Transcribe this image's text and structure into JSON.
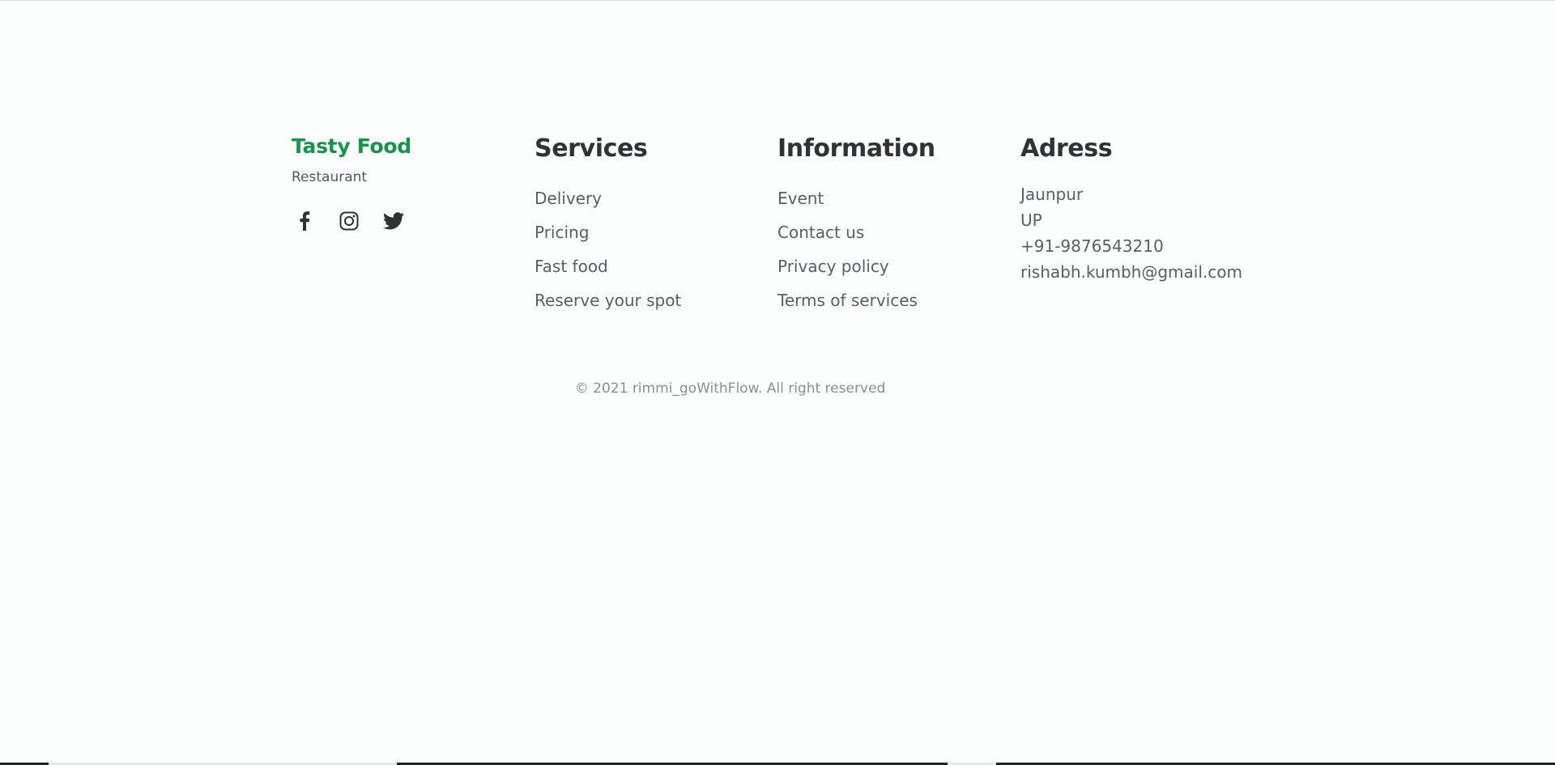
{
  "brand": {
    "name": "Tasty Food",
    "subtitle": "Restaurant",
    "accent_color": "#139647"
  },
  "socials": [
    {
      "icon": "facebook-icon"
    },
    {
      "icon": "instagram-icon"
    },
    {
      "icon": "twitter-icon"
    }
  ],
  "services": {
    "heading": "Services",
    "items": [
      "Delivery",
      "Pricing",
      "Fast food",
      "Reserve your spot"
    ]
  },
  "information": {
    "heading": "Information",
    "items": [
      "Event",
      "Contact us",
      "Privacy policy",
      "Terms of services"
    ]
  },
  "address": {
    "heading": "Adress",
    "lines": [
      "Jaunpur",
      "UP",
      "+91-9876543210",
      "rishabh.kumbh@gmail.com"
    ]
  },
  "copyright": "© 2021 rimmi_goWithFlow. All right reserved"
}
